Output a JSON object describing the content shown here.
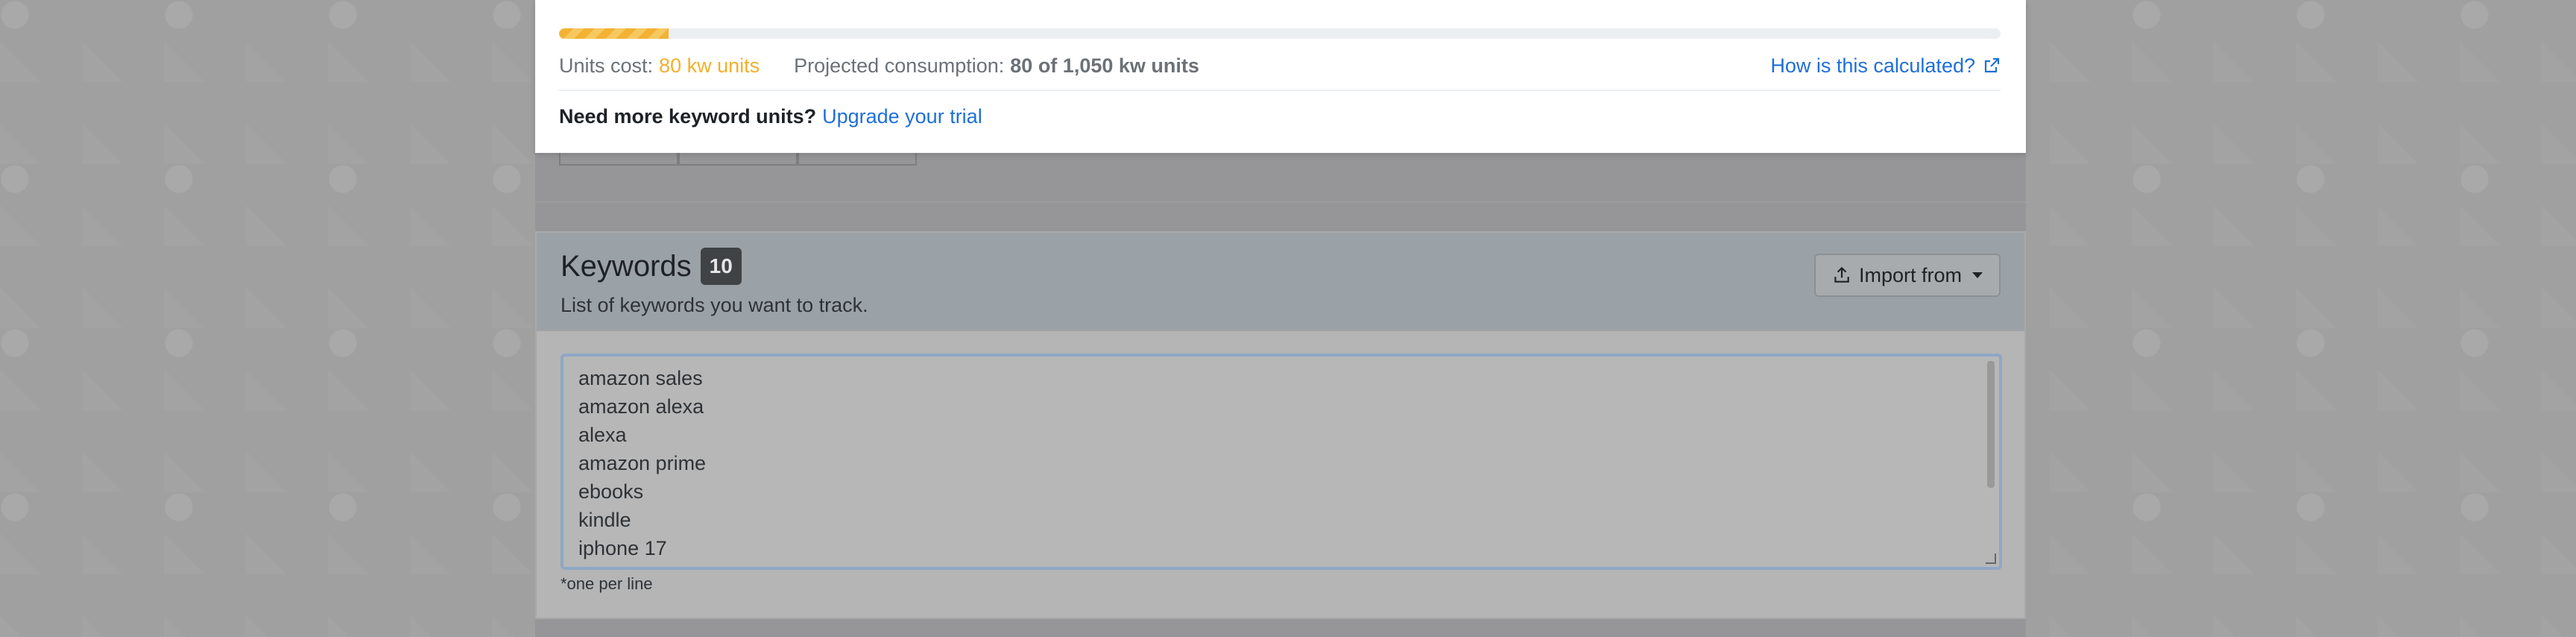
{
  "popup": {
    "usage_progress_fraction": 0.076,
    "units_cost_label": "Units cost:",
    "units_cost_value": "80 kw units",
    "projected_label": "Projected consumption:",
    "projected_value": "80 of 1,050 kw units",
    "calc_link": "How is this calculated?",
    "need_more_text": "Need more keyword units?",
    "upgrade_link": "Upgrade your trial"
  },
  "keywords": {
    "title": "Keywords",
    "count": "10",
    "subtitle": "List of keywords you want to track.",
    "import_label": "Import from",
    "lines": [
      "amazon sales",
      "amazon alexa",
      "alexa",
      "amazon prime",
      "ebooks",
      "kindle",
      "iphone 17"
    ],
    "hint": "*one per line"
  },
  "colors": {
    "accent_link": "#1e6fd8",
    "progress_fill": "#f3b234",
    "units_cost": "#f2b02a"
  },
  "icons": {
    "external_link": "external-link-icon",
    "import": "upload-icon",
    "dropdown": "chevron-down-icon"
  }
}
